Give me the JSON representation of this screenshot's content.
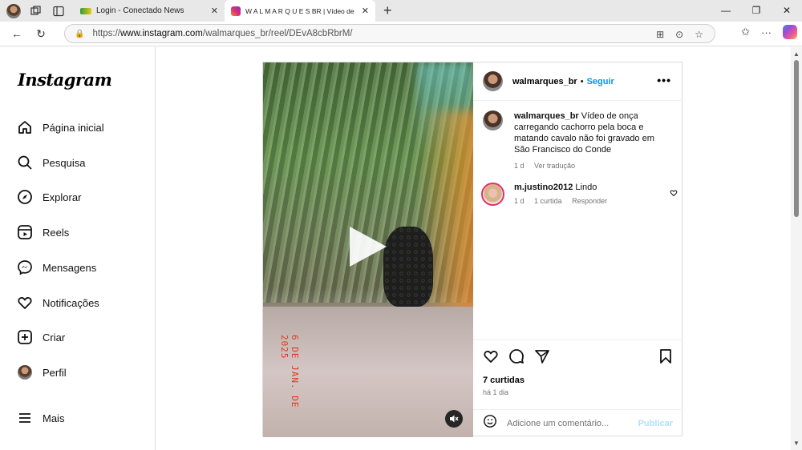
{
  "browser": {
    "tabs": [
      {
        "title": "Login - Conectado News",
        "active": false
      },
      {
        "title": "W A L M A R Q U E S  BR | Vídeo de",
        "active": true
      }
    ],
    "new_tab": "+",
    "url_prefix": "https://",
    "url_host": "www.instagram.com",
    "url_path": "/walmarques_br/reel/DEvA8cbRbrM/"
  },
  "sidebar": {
    "logo": "Instagram",
    "items": [
      {
        "label": "Página inicial",
        "icon": "home-icon"
      },
      {
        "label": "Pesquisa",
        "icon": "search-icon"
      },
      {
        "label": "Explorar",
        "icon": "compass-icon"
      },
      {
        "label": "Reels",
        "icon": "reels-icon"
      },
      {
        "label": "Mensagens",
        "icon": "messenger-icon"
      },
      {
        "label": "Notificações",
        "icon": "heart-icon"
      },
      {
        "label": "Criar",
        "icon": "plus-square-icon"
      },
      {
        "label": "Perfil",
        "icon": "avatar"
      },
      {
        "label": "Mais",
        "icon": "menu-icon"
      }
    ]
  },
  "post": {
    "video_stamp": "6 DE JAN. DE 2025",
    "author": "walmarques_br",
    "separator": "•",
    "follow": "Seguir",
    "more": "•••",
    "caption_user": "walmarques_br",
    "caption_text": " Vídeo de onça carregando cachorro pela boca e matando cavalo não foi gravado em São Francisco do Conde",
    "caption_time": "1 d",
    "caption_translate": "Ver tradução",
    "comment": {
      "user": "m.justino2012",
      "text": " Lindo",
      "time": "1 d",
      "likes": "1 curtida",
      "reply": "Responder"
    },
    "likes": "7 curtidas",
    "time": "há 1 dia",
    "add_comment_placeholder": "Adicione um comentário...",
    "publish": "Publicar"
  }
}
